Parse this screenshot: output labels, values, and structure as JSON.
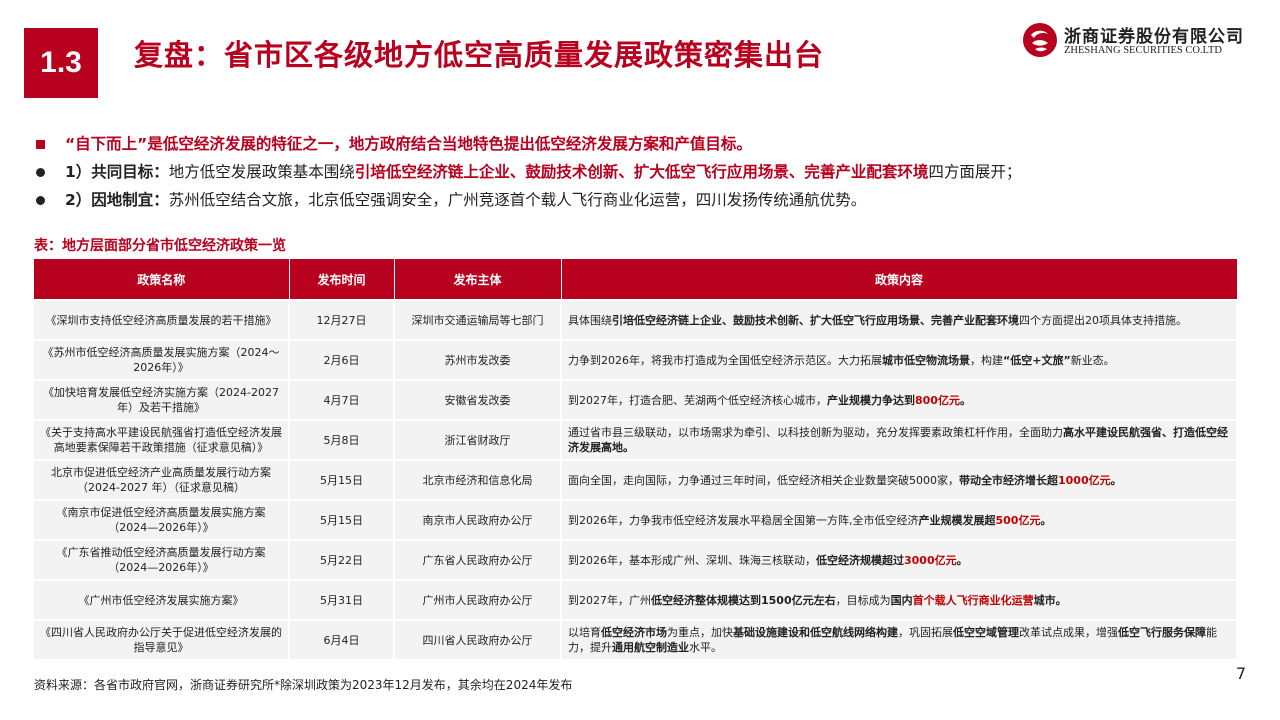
{
  "header": {
    "section_number": "1.3",
    "title": "复盘：省市区各级地方低空高质量发展政策密集出台"
  },
  "logo": {
    "name_cn": "浙商证券股份有限公司",
    "name_en": "ZHESHANG SECURITIES CO.LTD",
    "icon": "zheshang-logo-mark",
    "brand_color": "#b8001f"
  },
  "bullets": {
    "main": "“自下而上”是低空经济发展的特征之一，地方政府结合当地特色提出低空经济发展方案和产值目标。",
    "item1_label": "1）共同目标：",
    "item1_text_a": "地方低空发展政策基本围绕",
    "item1_text_b": "引培低空经济链上企业、鼓励技术创新、扩大低空飞行应用场景、完善产业配套环境",
    "item1_text_c": "四方面展开；",
    "item2_label": "2）因地制宜：",
    "item2_text": "苏州低空结合文旅，北京低空强调安全，广州竞逐首个载人飞行商业化运营，四川发扬传统通航优势。"
  },
  "table": {
    "caption": "表：地方层面部分省市低空经济政策一览",
    "headers": [
      "政策名称",
      "发布时间",
      "发布主体",
      "政策内容"
    ],
    "rows": [
      {
        "name": "《深圳市支持低空经济高质量发展的若干措施》",
        "date": "12月27日",
        "issuer": "深圳市交通运输局等七部门",
        "content": [
          {
            "t": "具体围绕",
            "s": ""
          },
          {
            "t": "引培低空经济链上企业、鼓励技术创新、扩大低空飞行应用场景、完善产业配套环境",
            "s": "strong"
          },
          {
            "t": "四个方面提出20项具体支持措施。",
            "s": ""
          }
        ]
      },
      {
        "name": "《苏州市低空经济高质量发展实施方案（2024～2026年）》",
        "date": "2月6日",
        "issuer": "苏州市发改委",
        "content": [
          {
            "t": "力争到2026年，将我市打造成为全国低空经济示范区。大力拓展",
            "s": ""
          },
          {
            "t": "城市低空物流场景",
            "s": "strong"
          },
          {
            "t": "，构建",
            "s": ""
          },
          {
            "t": "“低空+文旅”",
            "s": "strong"
          },
          {
            "t": "新业态。",
            "s": ""
          }
        ]
      },
      {
        "name": "《加快培育发展低空经济实施方案（2024-2027年）及若干措施》",
        "date": "4月7日",
        "issuer": "安徽省发改委",
        "content": [
          {
            "t": "到2027年，打造合肥、芜湖两个低空经济核心城市，",
            "s": ""
          },
          {
            "t": "产业规模力争达到",
            "s": "strong"
          },
          {
            "t": "800亿元",
            "s": "strong-red"
          },
          {
            "t": "。",
            "s": "strong"
          }
        ]
      },
      {
        "name": "《关于支持高水平建设民航强省打造低空经济发展高地要素保障若干政策措施（征求意见稿）》",
        "date": "5月8日",
        "issuer": "浙江省财政厅",
        "content": [
          {
            "t": "通过省市县三级联动，以市场需求为牵引、以科技创新为驱动，充分发挥要素政策杠杆作用，全面助力",
            "s": ""
          },
          {
            "t": "高水平建设民航强省、打造低空经济发展高地。",
            "s": "strong"
          }
        ]
      },
      {
        "name": "北京市促进低空经济产业高质量发展行动方案（2024-2027 年）（征求意见稿）",
        "date": "5月15日",
        "issuer": "北京市经济和信息化局",
        "content": [
          {
            "t": "面向全国，走向国际，力争通过三年时间，低空经济相关企业数量突破5000家，",
            "s": ""
          },
          {
            "t": "带动全市经济增长超",
            "s": "strong"
          },
          {
            "t": "1000亿元",
            "s": "strong-red"
          },
          {
            "t": "。",
            "s": "strong"
          }
        ]
      },
      {
        "name": "《南京市促进低空经济高质量发展实施方案（2024—2026年）》",
        "date": "5月15日",
        "issuer": "南京市人民政府办公厅",
        "content": [
          {
            "t": "到2026年，力争我市低空经济发展水平稳居全国第一方阵,全市低空经济",
            "s": ""
          },
          {
            "t": "产业规模发展超",
            "s": "strong"
          },
          {
            "t": "500亿元",
            "s": "strong-red"
          },
          {
            "t": "。",
            "s": "strong"
          }
        ]
      },
      {
        "name": "《广东省推动低空经济高质量发展行动方案（2024—2026年）》",
        "date": "5月22日",
        "issuer": "广东省人民政府办公厅",
        "content": [
          {
            "t": "到2026年，基本形成广州、深圳、珠海三核联动，",
            "s": ""
          },
          {
            "t": "低空经济规模超过",
            "s": "strong"
          },
          {
            "t": "3000亿元",
            "s": "strong-red"
          },
          {
            "t": "。",
            "s": "strong"
          }
        ]
      },
      {
        "name": "《广州市低空经济发展实施方案》",
        "date": "5月31日",
        "issuer": "广州市人民政府办公厅",
        "content": [
          {
            "t": "到2027年，广州",
            "s": ""
          },
          {
            "t": "低空经济整体规模达到1500亿元左右",
            "s": "strong"
          },
          {
            "t": "，目标成为",
            "s": ""
          },
          {
            "t": "国内",
            "s": "strong"
          },
          {
            "t": "首个载人飞行商业化运营",
            "s": "strong-red"
          },
          {
            "t": "城市。",
            "s": "strong"
          }
        ]
      },
      {
        "name": "《四川省人民政府办公厅关于促进低空经济发展的指导意见》",
        "date": "6月4日",
        "issuer": "四川省人民政府办公厅",
        "content": [
          {
            "t": "以培育",
            "s": ""
          },
          {
            "t": "低空经济市场",
            "s": "strong"
          },
          {
            "t": "为重点，加快",
            "s": ""
          },
          {
            "t": "基础设施建设和低空航线网络构建",
            "s": "strong"
          },
          {
            "t": "，巩固拓展",
            "s": ""
          },
          {
            "t": "低空空域管理",
            "s": "strong"
          },
          {
            "t": "改革试点成果，增强",
            "s": ""
          },
          {
            "t": "低空飞行服务保障",
            "s": "strong"
          },
          {
            "t": "能力，提升",
            "s": ""
          },
          {
            "t": "通用航空制造业",
            "s": "strong"
          },
          {
            "t": "水平。",
            "s": ""
          }
        ]
      }
    ]
  },
  "footer": {
    "source": "资料来源：各省市政府官网，浙商证券研究所*除深圳政策为2023年12月发布，其余均在2024年发布",
    "page_number": "7"
  }
}
